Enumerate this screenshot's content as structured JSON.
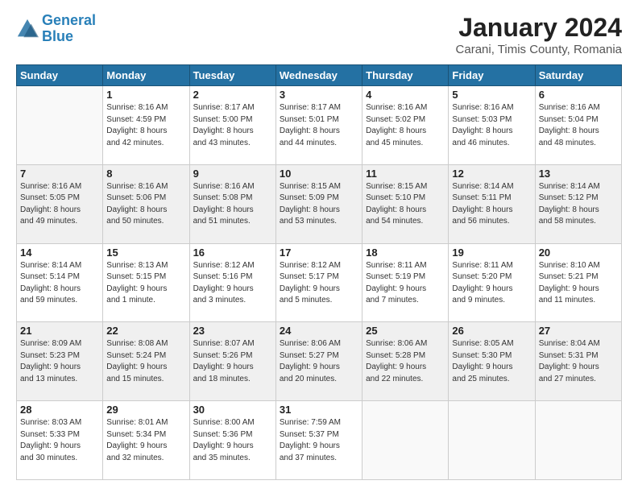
{
  "header": {
    "logo_line1": "General",
    "logo_line2": "Blue",
    "main_title": "January 2024",
    "subtitle": "Carani, Timis County, Romania"
  },
  "days_of_week": [
    "Sunday",
    "Monday",
    "Tuesday",
    "Wednesday",
    "Thursday",
    "Friday",
    "Saturday"
  ],
  "weeks": [
    [
      {
        "num": "",
        "info": ""
      },
      {
        "num": "1",
        "info": "Sunrise: 8:16 AM\nSunset: 4:59 PM\nDaylight: 8 hours\nand 42 minutes."
      },
      {
        "num": "2",
        "info": "Sunrise: 8:17 AM\nSunset: 5:00 PM\nDaylight: 8 hours\nand 43 minutes."
      },
      {
        "num": "3",
        "info": "Sunrise: 8:17 AM\nSunset: 5:01 PM\nDaylight: 8 hours\nand 44 minutes."
      },
      {
        "num": "4",
        "info": "Sunrise: 8:16 AM\nSunset: 5:02 PM\nDaylight: 8 hours\nand 45 minutes."
      },
      {
        "num": "5",
        "info": "Sunrise: 8:16 AM\nSunset: 5:03 PM\nDaylight: 8 hours\nand 46 minutes."
      },
      {
        "num": "6",
        "info": "Sunrise: 8:16 AM\nSunset: 5:04 PM\nDaylight: 8 hours\nand 48 minutes."
      }
    ],
    [
      {
        "num": "7",
        "info": "Sunrise: 8:16 AM\nSunset: 5:05 PM\nDaylight: 8 hours\nand 49 minutes."
      },
      {
        "num": "8",
        "info": "Sunrise: 8:16 AM\nSunset: 5:06 PM\nDaylight: 8 hours\nand 50 minutes."
      },
      {
        "num": "9",
        "info": "Sunrise: 8:16 AM\nSunset: 5:08 PM\nDaylight: 8 hours\nand 51 minutes."
      },
      {
        "num": "10",
        "info": "Sunrise: 8:15 AM\nSunset: 5:09 PM\nDaylight: 8 hours\nand 53 minutes."
      },
      {
        "num": "11",
        "info": "Sunrise: 8:15 AM\nSunset: 5:10 PM\nDaylight: 8 hours\nand 54 minutes."
      },
      {
        "num": "12",
        "info": "Sunrise: 8:14 AM\nSunset: 5:11 PM\nDaylight: 8 hours\nand 56 minutes."
      },
      {
        "num": "13",
        "info": "Sunrise: 8:14 AM\nSunset: 5:12 PM\nDaylight: 8 hours\nand 58 minutes."
      }
    ],
    [
      {
        "num": "14",
        "info": "Sunrise: 8:14 AM\nSunset: 5:14 PM\nDaylight: 8 hours\nand 59 minutes."
      },
      {
        "num": "15",
        "info": "Sunrise: 8:13 AM\nSunset: 5:15 PM\nDaylight: 9 hours\nand 1 minute."
      },
      {
        "num": "16",
        "info": "Sunrise: 8:12 AM\nSunset: 5:16 PM\nDaylight: 9 hours\nand 3 minutes."
      },
      {
        "num": "17",
        "info": "Sunrise: 8:12 AM\nSunset: 5:17 PM\nDaylight: 9 hours\nand 5 minutes."
      },
      {
        "num": "18",
        "info": "Sunrise: 8:11 AM\nSunset: 5:19 PM\nDaylight: 9 hours\nand 7 minutes."
      },
      {
        "num": "19",
        "info": "Sunrise: 8:11 AM\nSunset: 5:20 PM\nDaylight: 9 hours\nand 9 minutes."
      },
      {
        "num": "20",
        "info": "Sunrise: 8:10 AM\nSunset: 5:21 PM\nDaylight: 9 hours\nand 11 minutes."
      }
    ],
    [
      {
        "num": "21",
        "info": "Sunrise: 8:09 AM\nSunset: 5:23 PM\nDaylight: 9 hours\nand 13 minutes."
      },
      {
        "num": "22",
        "info": "Sunrise: 8:08 AM\nSunset: 5:24 PM\nDaylight: 9 hours\nand 15 minutes."
      },
      {
        "num": "23",
        "info": "Sunrise: 8:07 AM\nSunset: 5:26 PM\nDaylight: 9 hours\nand 18 minutes."
      },
      {
        "num": "24",
        "info": "Sunrise: 8:06 AM\nSunset: 5:27 PM\nDaylight: 9 hours\nand 20 minutes."
      },
      {
        "num": "25",
        "info": "Sunrise: 8:06 AM\nSunset: 5:28 PM\nDaylight: 9 hours\nand 22 minutes."
      },
      {
        "num": "26",
        "info": "Sunrise: 8:05 AM\nSunset: 5:30 PM\nDaylight: 9 hours\nand 25 minutes."
      },
      {
        "num": "27",
        "info": "Sunrise: 8:04 AM\nSunset: 5:31 PM\nDaylight: 9 hours\nand 27 minutes."
      }
    ],
    [
      {
        "num": "28",
        "info": "Sunrise: 8:03 AM\nSunset: 5:33 PM\nDaylight: 9 hours\nand 30 minutes."
      },
      {
        "num": "29",
        "info": "Sunrise: 8:01 AM\nSunset: 5:34 PM\nDaylight: 9 hours\nand 32 minutes."
      },
      {
        "num": "30",
        "info": "Sunrise: 8:00 AM\nSunset: 5:36 PM\nDaylight: 9 hours\nand 35 minutes."
      },
      {
        "num": "31",
        "info": "Sunrise: 7:59 AM\nSunset: 5:37 PM\nDaylight: 9 hours\nand 37 minutes."
      },
      {
        "num": "",
        "info": ""
      },
      {
        "num": "",
        "info": ""
      },
      {
        "num": "",
        "info": ""
      }
    ]
  ]
}
